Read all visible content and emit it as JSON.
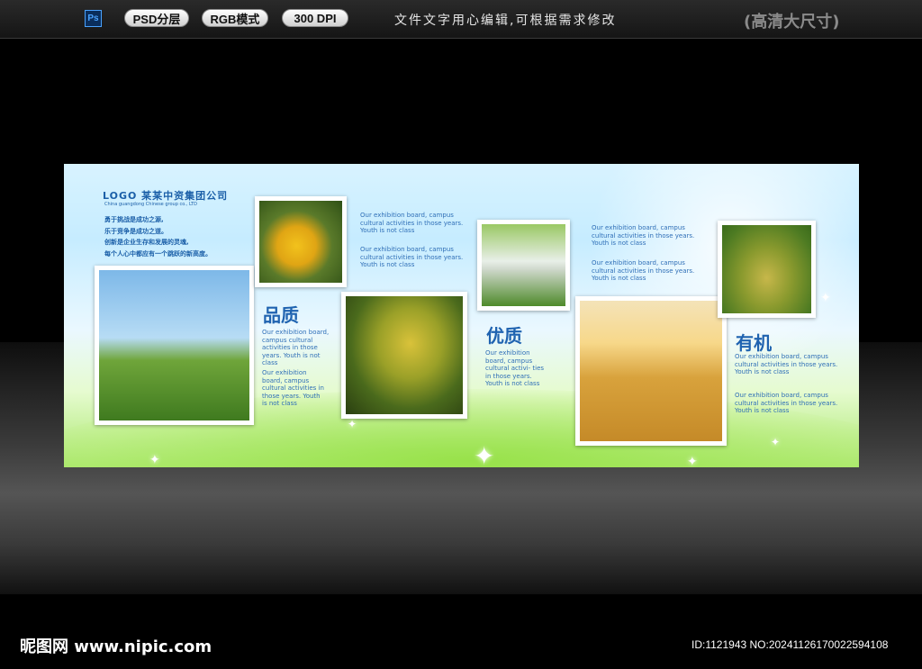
{
  "topbar": {
    "ps_icon": "Ps",
    "badges": [
      "PSD分层",
      "RGB模式",
      "300 DPI"
    ],
    "note": "文件文字用心编辑,可根据需求修改",
    "resolution": "(高清大尺寸)"
  },
  "board": {
    "logo": "LOGO 某某中资集团公司",
    "logo_sub": "China guangdong Chinese group co., LTD",
    "mottos": [
      "勇于挑战是成功之源,",
      "乐于竞争是成功之道。",
      "创新是企业生存和发展的灵魂,",
      "每个人心中都应有一个跳跃的新高度。"
    ],
    "sections": [
      {
        "heading": "品质",
        "text1": "Our exhibition board, campus cultural activities in those years. Youth is not class",
        "text2": "Our exhibition board, campus cultural activities in those years. Youth is not class"
      },
      {
        "heading": "优质",
        "text_top": "Our exhibition board, campus cultural activities in those years. Youth is not class",
        "text_top2": "Our exhibition board, campus cultural activities in those years. Youth is not class",
        "text1": "Our exhibition board, campus cultural activi- ties in those years. Youth is not class"
      },
      {
        "heading": "有机",
        "text_top": "Our exhibition board, campus cultural activities in those years. Youth is not class",
        "text_top2": "Our exhibition board, campus cultural activities in those years. Youth is not class",
        "text1": "Our exhibition board, campus cultural activities in those years. Youth is not class",
        "text2": "Our exhibition board, campus cultural activities in those years. Youth is not class"
      }
    ],
    "photos": [
      "wheat-photo",
      "corn-photo",
      "millet-photo",
      "hands-seedlings-photo",
      "farmer-field-photo",
      "rice-photo"
    ]
  },
  "footer": {
    "watermark": "昵图网 www.nipic.com",
    "id_line": "ID:1121943 NO:20241126170022594108"
  }
}
